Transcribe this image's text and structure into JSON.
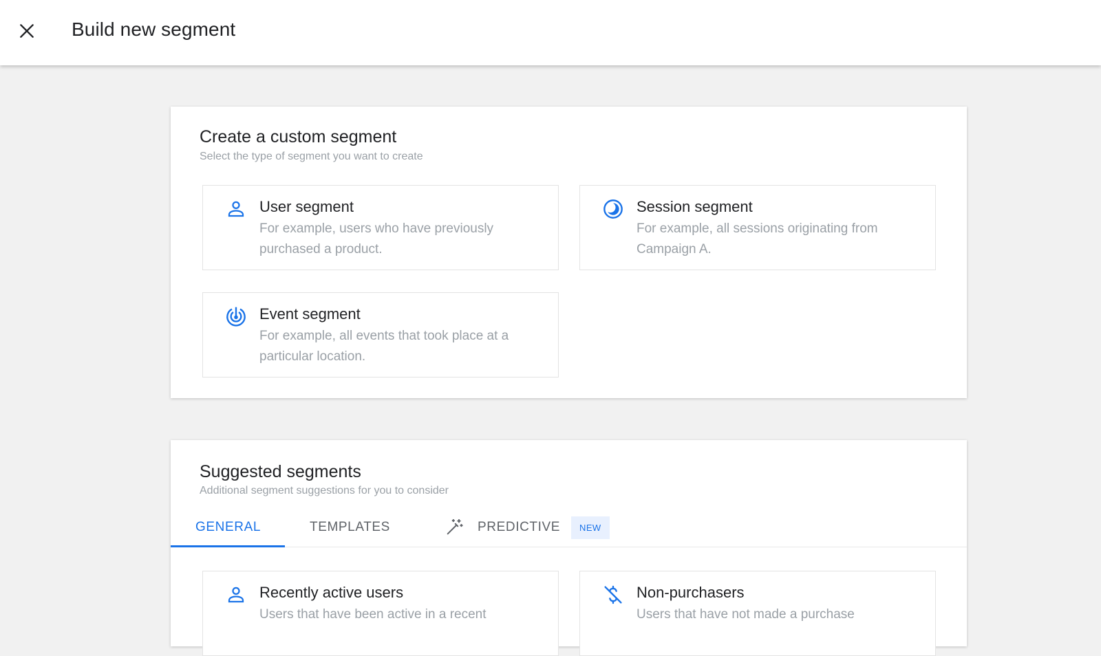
{
  "header": {
    "title": "Build new segment"
  },
  "custom": {
    "title": "Create a custom segment",
    "subtitle": "Select the type of segment you want to create",
    "options": [
      {
        "icon": "person-icon",
        "title": "User segment",
        "desc": "For example, users who have previously purchased a product."
      },
      {
        "icon": "session-icon",
        "title": "Session segment",
        "desc": "For example, all sessions originating from Campaign A."
      },
      {
        "icon": "event-icon",
        "title": "Event segment",
        "desc": "For example, all events that took place at a particular location."
      }
    ]
  },
  "suggested": {
    "title": "Suggested segments",
    "subtitle": "Additional segment suggestions for you to consider",
    "tabs": [
      {
        "label": "GENERAL",
        "active": true
      },
      {
        "label": "TEMPLATES",
        "active": false
      },
      {
        "label": "PREDICTIVE",
        "active": false,
        "badge": "NEW",
        "icon": "magic-wand-icon"
      }
    ],
    "items": [
      {
        "icon": "person-icon",
        "title": "Recently active users",
        "desc": "Users that have been active in a recent"
      },
      {
        "icon": "no-purchase-icon",
        "title": "Non-purchasers",
        "desc": "Users that have not made a purchase"
      }
    ]
  },
  "colors": {
    "accent": "#1a73e8",
    "muted_text": "#9aa0a6",
    "background": "#f1f1f1"
  }
}
